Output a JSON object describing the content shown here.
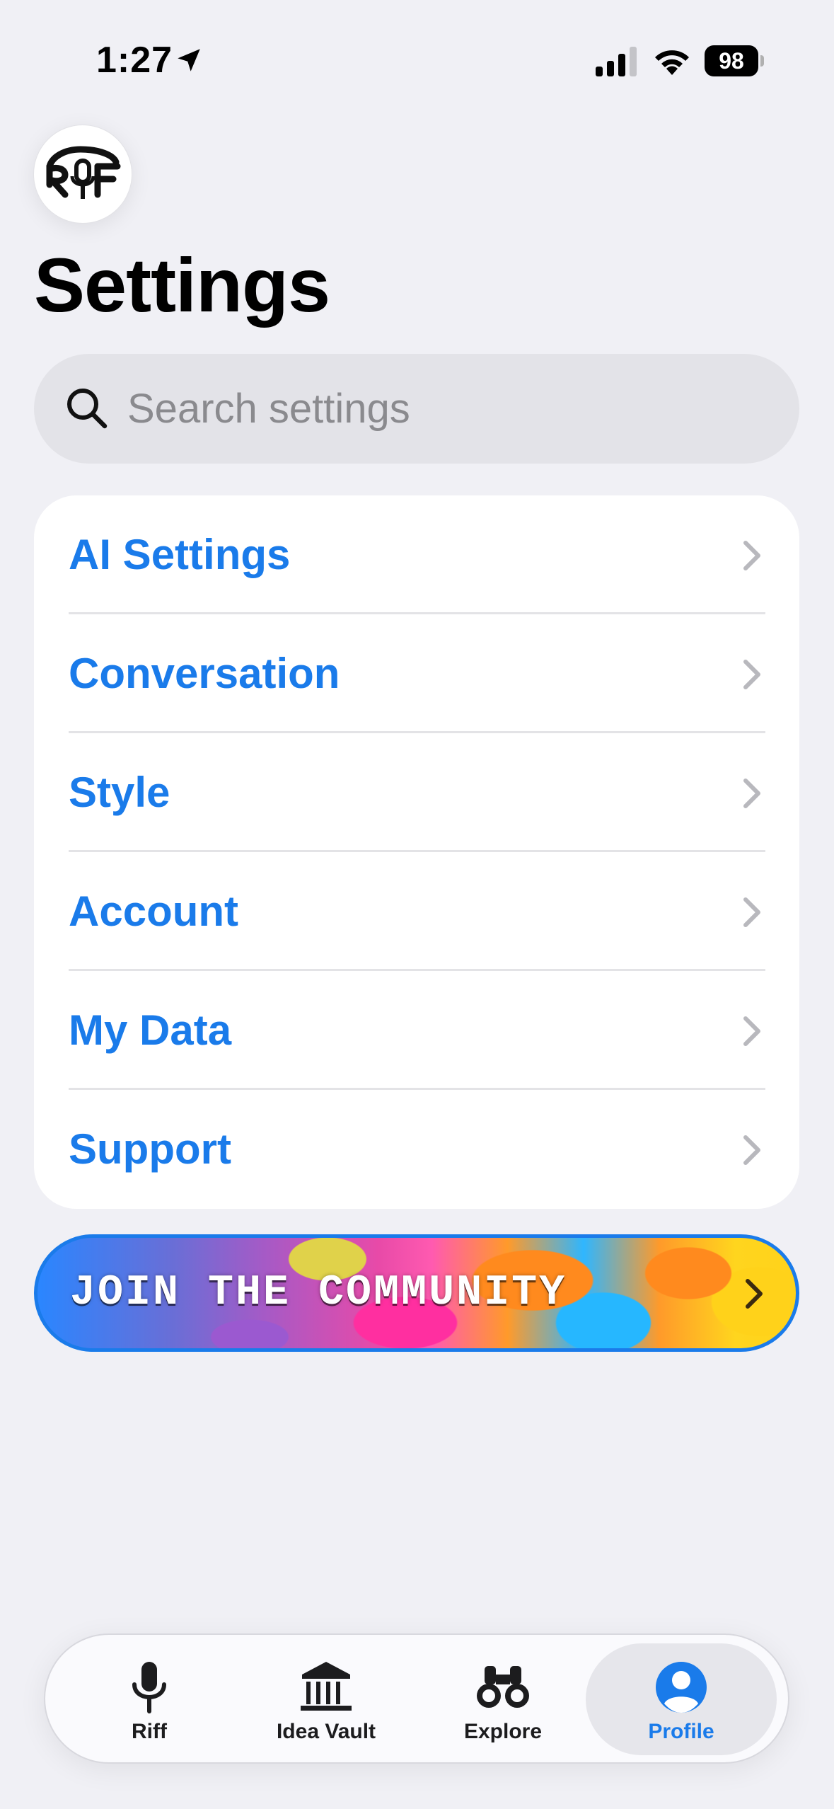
{
  "status_bar": {
    "time": "1:27",
    "battery": "98"
  },
  "app": {
    "logo_text": "RIF"
  },
  "page": {
    "title": "Settings"
  },
  "search": {
    "placeholder": "Search settings",
    "value": ""
  },
  "settings": {
    "items": [
      {
        "label": "AI Settings"
      },
      {
        "label": "Conversation"
      },
      {
        "label": "Style"
      },
      {
        "label": "Account"
      },
      {
        "label": "My Data"
      },
      {
        "label": "Support"
      }
    ]
  },
  "community": {
    "label": "JOIN THE COMMUNITY"
  },
  "tabs": [
    {
      "label": "Riff",
      "icon": "microphone-icon",
      "active": false
    },
    {
      "label": "Idea Vault",
      "icon": "bank-icon",
      "active": false
    },
    {
      "label": "Explore",
      "icon": "binoculars-icon",
      "active": false
    },
    {
      "label": "Profile",
      "icon": "person-circle-icon",
      "active": true
    }
  ],
  "colors": {
    "accent": "#1a7bea",
    "background": "#f0f0f5",
    "card": "#ffffff",
    "search_bg": "#e3e3e8"
  }
}
